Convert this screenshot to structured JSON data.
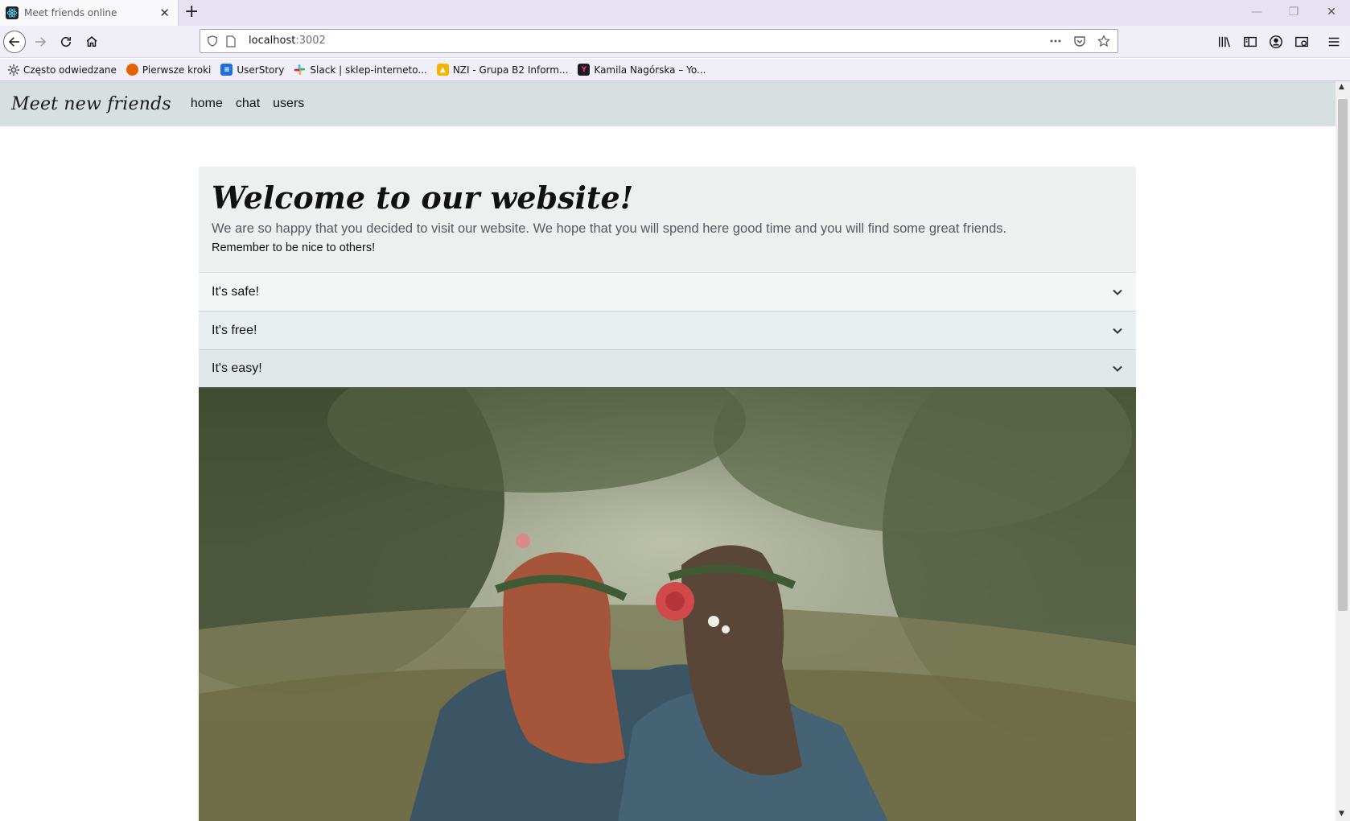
{
  "browser": {
    "tab": {
      "title": "Meet friends online",
      "close_glyph": "✕"
    },
    "new_tab_glyph": "+",
    "window_controls": {
      "minimize": "—",
      "restore": "❐",
      "close": "✕"
    },
    "url": {
      "host": "localhost",
      "port": ":3002"
    },
    "url_actions": [
      "more-icon",
      "pocket-icon",
      "bookmark-star-icon"
    ],
    "toolbar_icons": [
      "library-icon",
      "sidebar-icon",
      "account-icon",
      "screenshot-icon",
      "menu-icon"
    ],
    "bookmarks": [
      {
        "label": "Często odwiedzane",
        "icon": "gear-icon",
        "color": "#5b5b66"
      },
      {
        "label": "Pierwsze kroki",
        "icon": "firefox-icon",
        "color": "#e66000"
      },
      {
        "label": "UserStory",
        "icon": "doc-icon",
        "color": "#1e6fd9"
      },
      {
        "label": "Slack | sklep-interneto...",
        "icon": "slack-icon",
        "color": "#4a154b"
      },
      {
        "label": "NZI - Grupa B2 Inform...",
        "icon": "classroom-icon",
        "color": "#f4b400"
      },
      {
        "label": "Kamila Nagórska – Yo...",
        "icon": "yt-icon",
        "color": "#1c1b22"
      }
    ]
  },
  "site": {
    "brand": "Meet new friends",
    "nav": {
      "home": "home",
      "chat": "chat",
      "users": "users"
    }
  },
  "welcome": {
    "title": "Welcome to our website!",
    "lead": "We are so happy that you decided to visit our website. We hope that you will spend here good time and you will find some great friends.",
    "note": "Remember to be nice to others!"
  },
  "accordion": [
    {
      "label": "It's safe!"
    },
    {
      "label": "It's free!"
    },
    {
      "label": "It's easy!"
    }
  ],
  "colors": {
    "nav_bg": "#d8dfe1",
    "card_bg": "#eef0f0",
    "chrome_bg": "#f0eef7"
  }
}
